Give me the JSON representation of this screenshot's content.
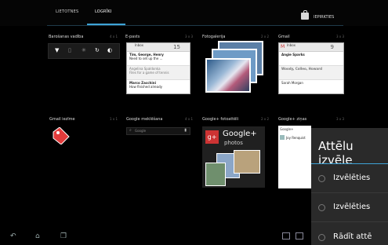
{
  "tabs": {
    "apps": "LIETOTNES",
    "widgets": "LOGRĪKI"
  },
  "store_label": "IEPIRKTIES",
  "widgets": {
    "w1": {
      "title": "Barošanas vadība",
      "size": "4 x 1"
    },
    "w2": {
      "title": "E-pasts",
      "size": "3 x 3"
    },
    "w3": {
      "title": "Fotogalerija",
      "size": "2 x 2"
    },
    "w4": {
      "title": "Gmail",
      "size": "3 x 3"
    },
    "w5": {
      "title": "Gmail iezīme",
      "size": "1 x 1"
    },
    "w6": {
      "title": "Google meklēšana",
      "size": "4 x 1"
    },
    "w7": {
      "title": "Google+ fotoattēli",
      "size": "2 x 2"
    },
    "w8": {
      "title": "Google+ ziņas",
      "size": "3 x 3"
    }
  },
  "email_preview": {
    "header": "Inbox",
    "count": "15",
    "r1_from": "Tim, George, Henry",
    "r1_text": "Need to set up the ...",
    "r2_from": "Angelina Spaldonka",
    "r2_text": "Files for a game of tennis",
    "r3_from": "Marco Zacchini",
    "r3_text": "How finished already"
  },
  "gmail_preview": {
    "header": "Inbox",
    "count": "9",
    "r1_from": "Angie Sparks",
    "r2_from": "Woody, Colleo, Howard",
    "r3_from": "Sarah Morgan"
  },
  "search_hint": "Google",
  "gplus": {
    "brand": "Google+",
    "sub": "photos",
    "badge": "g+"
  },
  "gplus_news_header": "Google+",
  "gplus_news_user": "Joy Renquist",
  "dialog": {
    "title": "Attēlu izvēle",
    "opt1": "Izvēlēties",
    "opt2": "Izvēlēties",
    "opt3": "Rādīt attē"
  }
}
